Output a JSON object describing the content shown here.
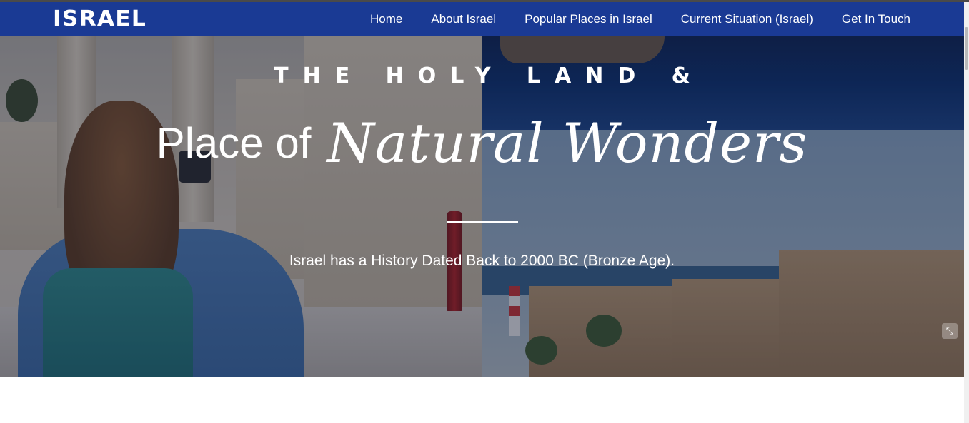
{
  "brand": {
    "logo_text": "ISRAEL"
  },
  "nav": {
    "items": [
      {
        "label": "Home"
      },
      {
        "label": "About Israel"
      },
      {
        "label": "Popular Places in Israel"
      },
      {
        "label": "Current Situation (Israel)"
      },
      {
        "label": "Get In Touch"
      }
    ]
  },
  "hero": {
    "kicker": "THE HOLY LAND &",
    "headline_plain": "Place of",
    "headline_script": "Natural Wonders",
    "subtitle": "Israel has a History Dated Back to 2000 BC (Bronze Age).",
    "overlay_color": "#121a34",
    "corner_icon": "expand-icon"
  },
  "colors": {
    "navbar": "#1a3a94",
    "text": "#ffffff"
  }
}
